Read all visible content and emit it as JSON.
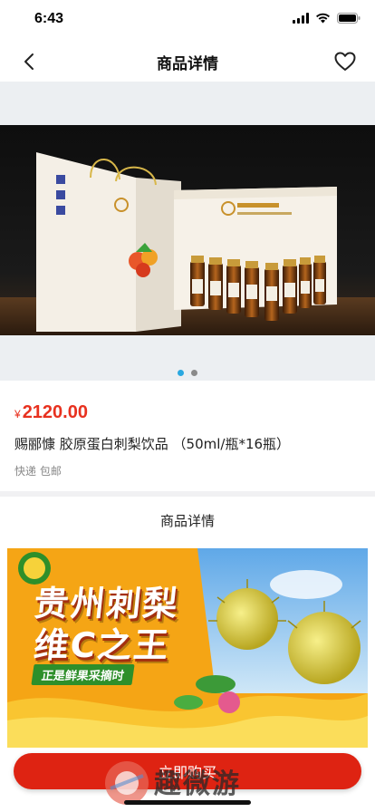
{
  "status_bar": {
    "time": "6:43",
    "icons": [
      "signal-icon",
      "wifi-icon",
      "battery-icon"
    ]
  },
  "nav": {
    "title": "商品详情",
    "back_icon": "chevron-left-icon",
    "favorite_icon": "heart-outline-icon"
  },
  "gallery": {
    "image_description": "gift boxes and bottled drinks",
    "page_count": 2,
    "current_page": 1,
    "product_brand_label": "赐郦慷",
    "box_label": "胶原蛋白刺梨饮品",
    "bag_side_label": "胶原蛋白刺梨饮品"
  },
  "product": {
    "currency": "¥",
    "price": "2120.00",
    "name": "赐郦慷 胶原蛋白刺梨饮品 （50ml/瓶*16瓶）",
    "shipping": "快递 包邮"
  },
  "detail": {
    "section_title": "商品详情",
    "banner_line_1": "贵州刺梨",
    "banner_line_2": "维C之王",
    "banner_tag": "正是鲜果采摘时"
  },
  "action": {
    "buy_label": "立即购买"
  },
  "watermark": {
    "text": "趣微游"
  },
  "colors": {
    "price": "#e8311f",
    "buy_button": "#de2312",
    "dot_active": "#2aa8e0"
  }
}
